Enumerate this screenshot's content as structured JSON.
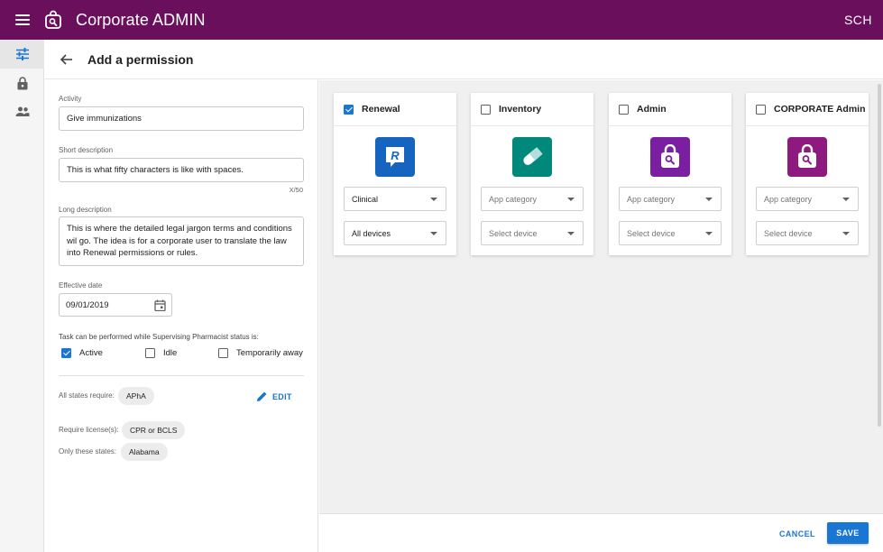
{
  "app": {
    "title": "Corporate ADMIN",
    "user": "SCH"
  },
  "rail": {
    "items": [
      {
        "icon": "tune-icon",
        "active": true
      },
      {
        "icon": "lock-icon",
        "active": false
      },
      {
        "icon": "people-icon",
        "active": false
      }
    ]
  },
  "header": {
    "title": "Add a permission"
  },
  "form": {
    "activity": {
      "label": "Activity",
      "value": "Give immunizations"
    },
    "short_description": {
      "label": "Short description",
      "value": "This is what fifty characters is like with spaces.",
      "counter": "X/50"
    },
    "long_description": {
      "label": "Long description",
      "value": "This is where the detailed legal jargon terms and conditions wil go. The idea is for a corporate user to translate the law into Renewal permissions or rules."
    },
    "effective_date": {
      "label": "Effective date",
      "value": "09/01/2019"
    },
    "status_question": "Task can be performed while Supervising Pharmacist status is:",
    "statuses": [
      {
        "label": "Active",
        "checked": true
      },
      {
        "label": "Idle",
        "checked": false
      },
      {
        "label": "Temporarily away",
        "checked": false
      }
    ],
    "all_states": {
      "label": "All states require:",
      "chip": "APhA"
    },
    "edit_label": "EDIT",
    "licenses": {
      "label": "Require license(s):",
      "chip": "CPR or BCLS"
    },
    "states": {
      "label": "Only these states:",
      "chip": "Alabama"
    }
  },
  "apps": [
    {
      "name": "Renewal",
      "checked": true,
      "icon": "renewal-r-icon",
      "icon_color": "#1565c0",
      "category": "Clinical",
      "category_placeholder": false,
      "device": "All devices",
      "device_placeholder": false
    },
    {
      "name": "Inventory",
      "checked": false,
      "icon": "pill-icon",
      "icon_color": "#00897b",
      "category": "App category",
      "category_placeholder": true,
      "device": "Select device",
      "device_placeholder": true
    },
    {
      "name": "Admin",
      "checked": false,
      "icon": "admin-lock-icon",
      "icon_color": "#7b1fa2",
      "category": "App category",
      "category_placeholder": true,
      "device": "Select device",
      "device_placeholder": true
    },
    {
      "name": "CORPORATE Admin",
      "checked": false,
      "icon": "corporate-lock-icon",
      "icon_color": "#8e1a7f",
      "category": "App category",
      "category_placeholder": true,
      "device": "Select device",
      "device_placeholder": true
    }
  ],
  "footer": {
    "cancel": "CANCEL",
    "save": "SAVE"
  }
}
